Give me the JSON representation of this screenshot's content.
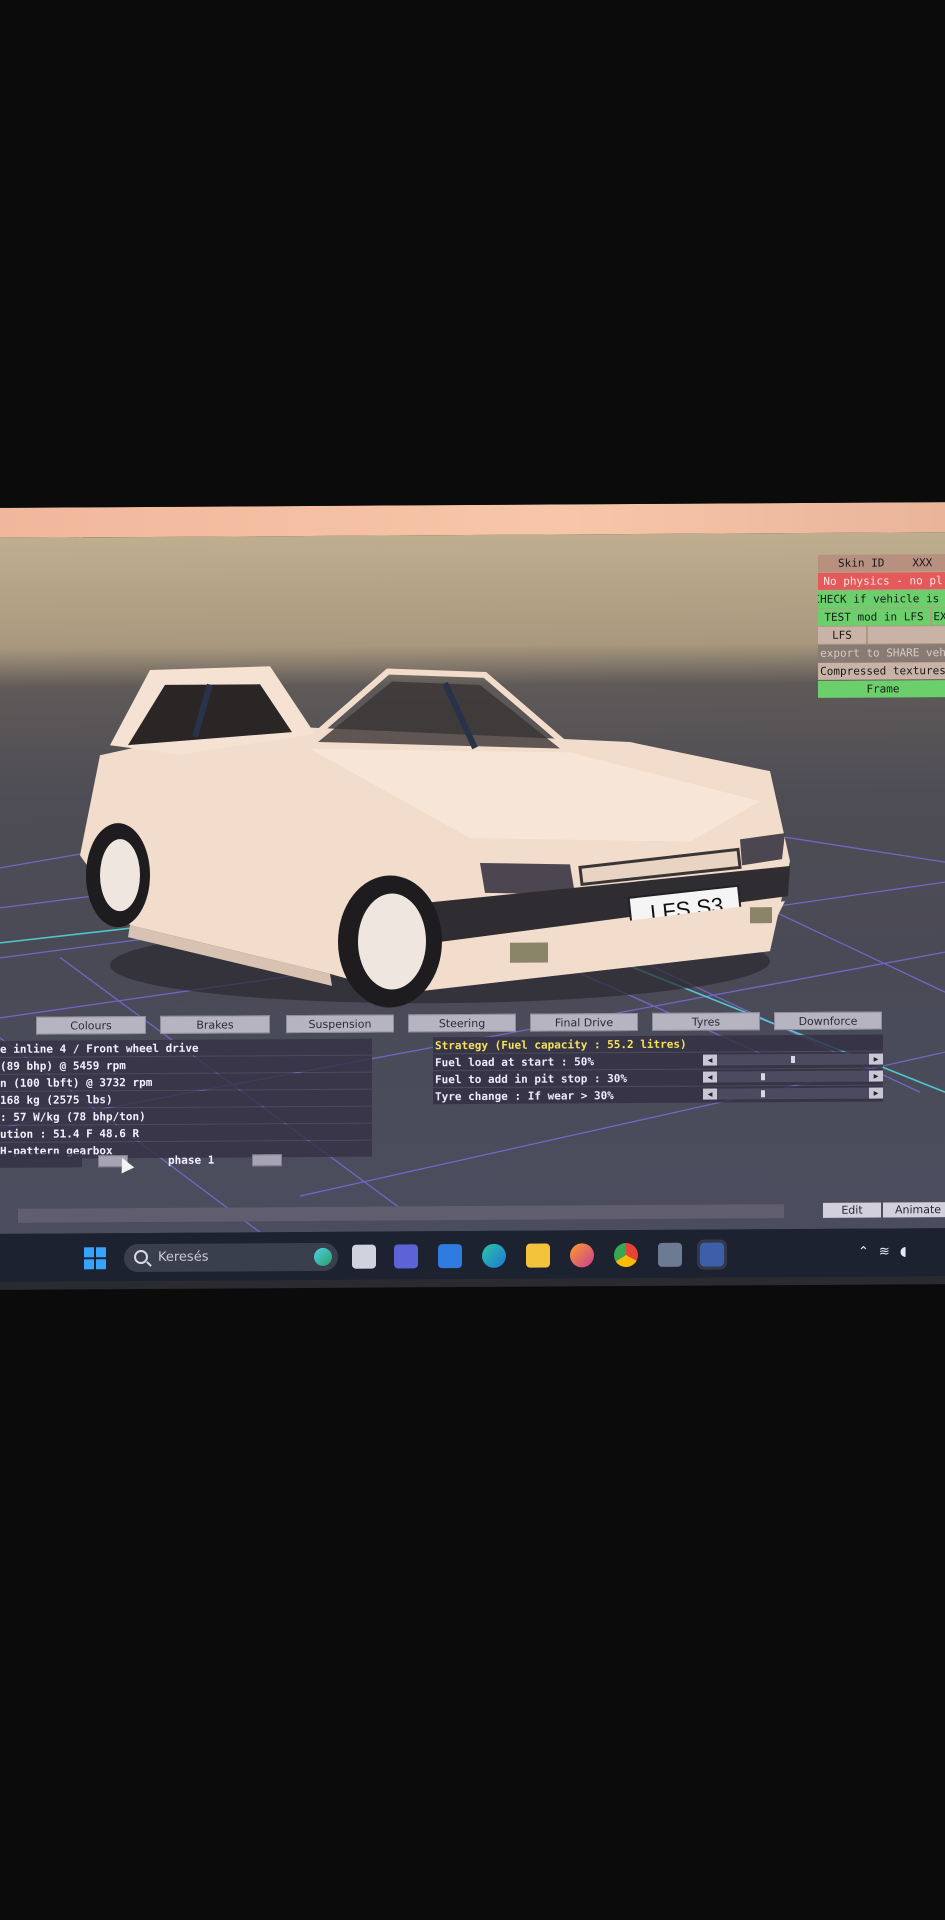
{
  "skin_panel": {
    "skin_id": "Skin ID",
    "skin_xxx": "XXX",
    "no_physics": "No physics - no pl",
    "check_vehicle": "CHECK if vehicle is v",
    "test_mod": "TEST mod in LFS",
    "test_mod_ex": "EX",
    "lfs": "LFS",
    "export_share": "export to SHARE veh",
    "compressed_textures": "Compressed textures",
    "frame": "Frame"
  },
  "car": {
    "plate": "LFS S3"
  },
  "tabs": [
    "Colours",
    "Brakes",
    "Suspension",
    "Steering",
    "Final Drive",
    "Tyres",
    "Downforce"
  ],
  "info_lines": [
    "e inline 4 / Front wheel drive",
    "(89 bhp) @ 5459 rpm",
    "n (100 lbft) @ 3732 rpm",
    "168 kg (2575 lbs)",
    ": 57 W/kg (78 bhp/ton)",
    "ution : 51.4 F  48.6 R",
    "H-pattern gearbox"
  ],
  "phase": {
    "label": "phase 1"
  },
  "strategy": {
    "title": "Strategy (Fuel capacity : 55.2 litres)",
    "rows": [
      {
        "label": "Fuel load at start : 50%",
        "value": 0.5
      },
      {
        "label": "Fuel to add in pit stop : 30%",
        "value": 0.3
      },
      {
        "label": "Tyre change : If wear > 30%",
        "value": 0.3
      }
    ]
  },
  "bottom": {
    "edit": "Edit",
    "animate": "Animate"
  },
  "taskbar": {
    "search_placeholder": "Keresés",
    "icons": [
      "task-view-icon",
      "teams-icon",
      "mail-icon",
      "edge-icon",
      "file-explorer-icon",
      "firefox-icon",
      "chrome-icon",
      "lfs-app-icon",
      "lfs-editor-icon"
    ],
    "tray": [
      "chevron-up-icon",
      "wifi-icon",
      "speaker-icon"
    ]
  },
  "colors": {
    "panel_green": "#6bcf6b",
    "panel_red": "#e45a5a",
    "strategy_title": "#f4e25a",
    "grid_cyan": "#4fd6d6",
    "grid_purple": "#7a6ad8",
    "car_body": "#f2dccb"
  }
}
